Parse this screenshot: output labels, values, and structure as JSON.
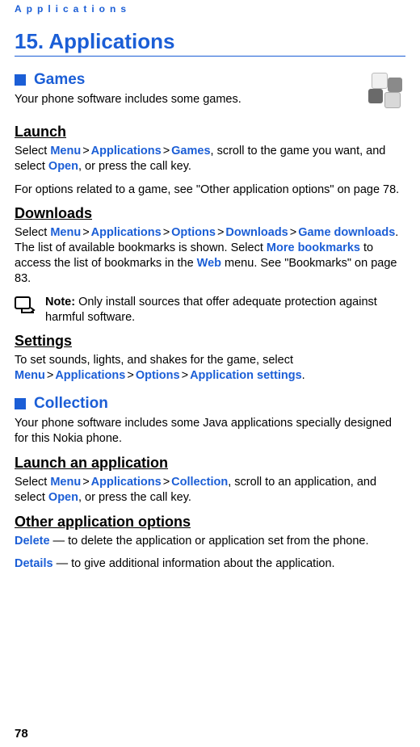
{
  "header": {
    "running": "Applications"
  },
  "chapter": {
    "title": "15. Applications"
  },
  "games": {
    "heading": "Games",
    "intro": "Your phone software includes some games.",
    "launch_h": "Launch",
    "launch_pre": "Select ",
    "menu": "Menu",
    "applications": "Applications",
    "games_kw": "Games",
    "launch_mid": ", scroll to the game you want, and select ",
    "open": "Open",
    "launch_tail": ", or press the call key.",
    "see_line": "For options related to a game, see \"Other application options\" on page 78.",
    "downloads_h": "Downloads",
    "dl_pre": "Select ",
    "options": "Options",
    "downloads_kw": "Downloads",
    "game_downloads": "Game downloads",
    "dl_mid1": ". The list of available bookmarks is shown. Select ",
    "more_bookmarks": "More bookmarks",
    "dl_mid2": " to access the list of bookmarks in the ",
    "web": "Web",
    "dl_tail": " menu. See \"Bookmarks\" on page 83.",
    "note_label": "Note:",
    "note_body": " Only install sources that offer adequate protection against harmful software.",
    "settings_h": "Settings",
    "settings_pre": "To set sounds, lights, and shakes for the game, select ",
    "app_settings": "Application settings",
    "settings_tail": "."
  },
  "collection": {
    "heading": "Collection",
    "intro": "Your phone software includes some Java applications specially designed for this Nokia phone.",
    "launch_app_h": "Launch an application",
    "launch_pre": "Select ",
    "menu": "Menu",
    "applications": "Applications",
    "collection_kw": "Collection",
    "launch_mid": ", scroll to an application, and select ",
    "open": "Open",
    "launch_tail": ", or press the call key.",
    "other_h": "Other application options",
    "delete_kw": "Delete",
    "delete_body": " — to delete the application or application set from the phone.",
    "details_kw": "Details",
    "details_body": " — to give additional information about the application."
  },
  "gt": ">",
  "page": "78"
}
